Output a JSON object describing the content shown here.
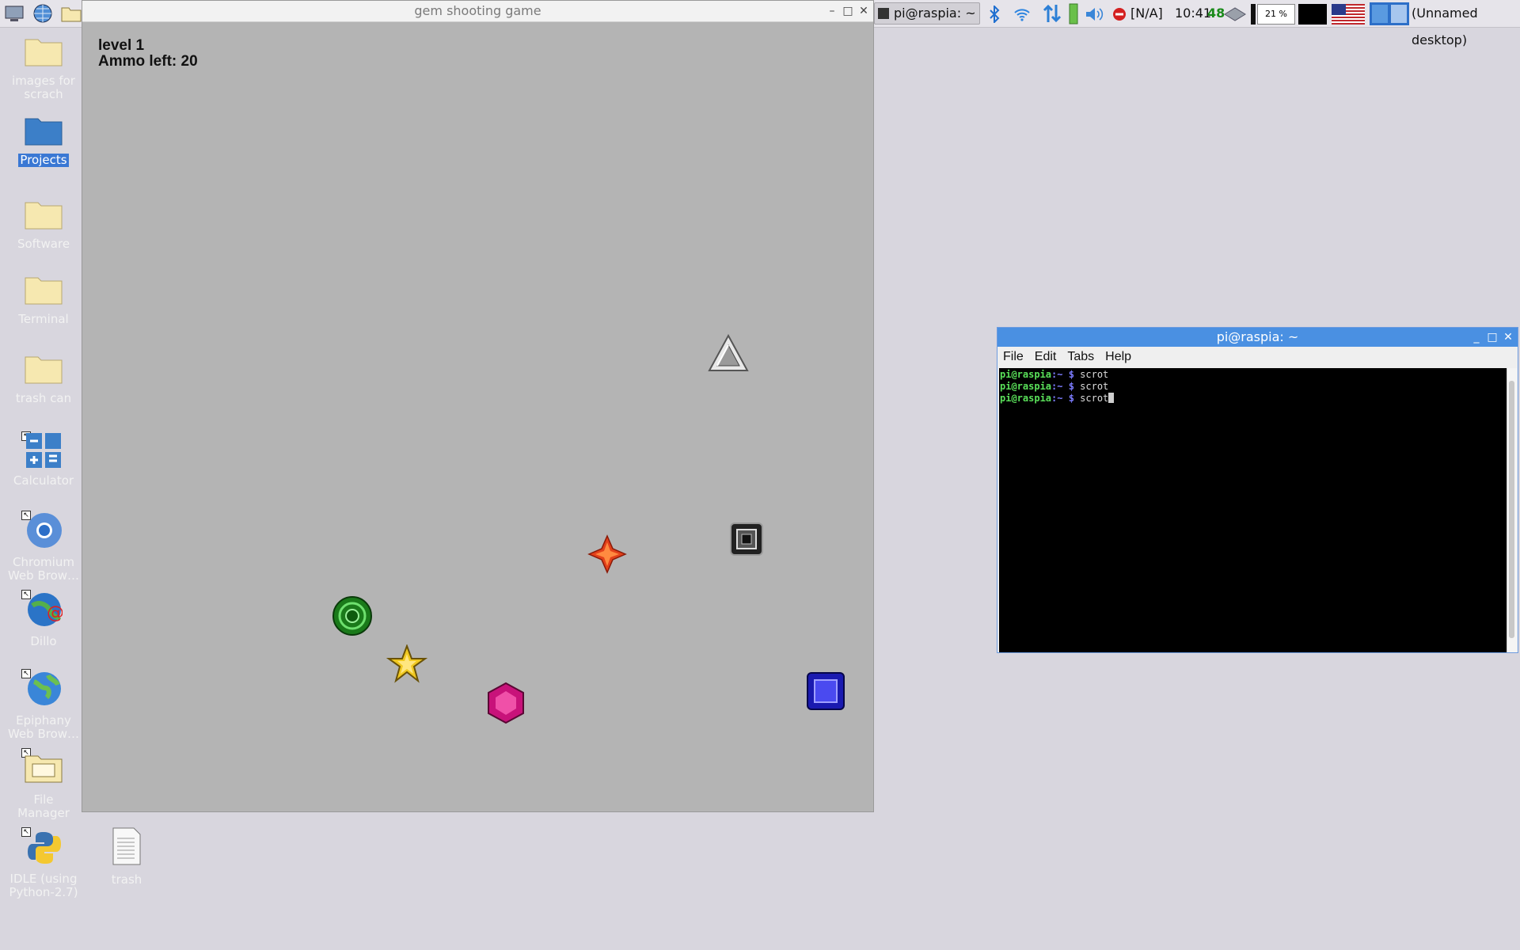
{
  "taskbar": {
    "task_terminal": "pi@raspia: ~",
    "net_status": "[N/A]",
    "clock": "10:41",
    "temperature": "48",
    "cpu": "21 %",
    "desktop": "(Unnamed desktop)"
  },
  "desktop": {
    "icons": [
      {
        "label": "images for scrach"
      },
      {
        "label": "Projects"
      },
      {
        "label": "Software"
      },
      {
        "label": "Terminal"
      },
      {
        "label": "trash can"
      },
      {
        "label": "Calculator"
      },
      {
        "label": "Chromium Web Brow…"
      },
      {
        "label": "Dillo"
      },
      {
        "label": "Epiphany Web Brow…"
      },
      {
        "label": "File Manager"
      },
      {
        "label": "IDLE (using Python-2.7)"
      },
      {
        "label": "trash"
      }
    ]
  },
  "game": {
    "title": "gem shooting game",
    "level": "level 1",
    "ammo": "Ammo left: 20",
    "gems": [
      "silver-triangle",
      "black-square",
      "red-diamond",
      "green-orb",
      "yellow-star",
      "pink-hexagon",
      "blue-square"
    ]
  },
  "terminal": {
    "title": "pi@raspia: ~",
    "menu": [
      "File",
      "Edit",
      "Tabs",
      "Help"
    ],
    "lines": [
      {
        "user": "pi@raspia",
        "path": ":~ $",
        "cmd": " scrot"
      },
      {
        "user": "pi@raspia",
        "path": ":~ $",
        "cmd": " scrot"
      },
      {
        "user": "pi@raspia",
        "path": ":~ $",
        "cmd": " scrot"
      }
    ]
  },
  "colors": {
    "desktop_bg": "#d8d6de",
    "game_bg": "#b4b4b4",
    "terminal_title": "#4a90e2",
    "selection": "#3a78d4"
  }
}
